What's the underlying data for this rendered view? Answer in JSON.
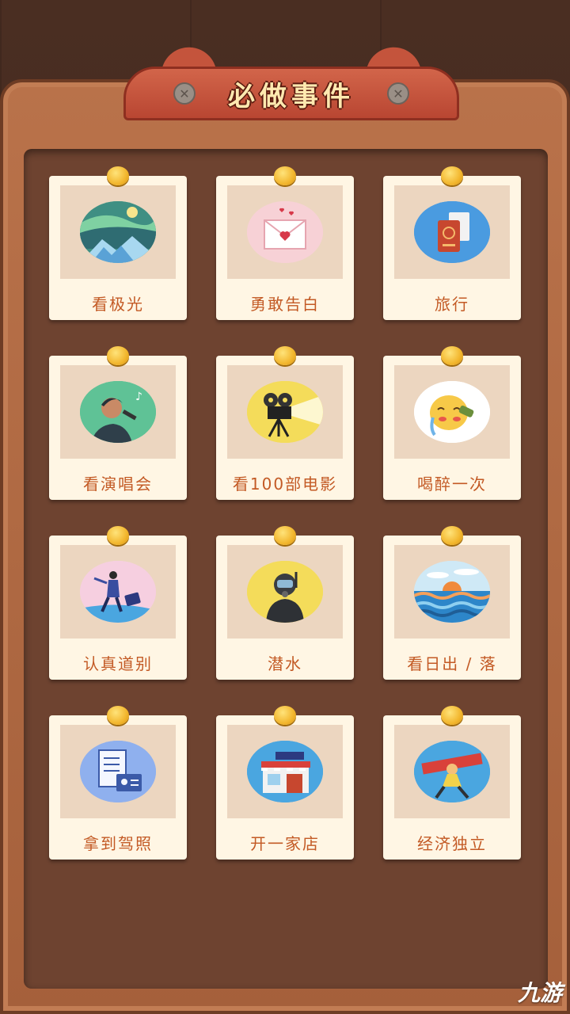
{
  "title": "必做事件",
  "cards": [
    {
      "label": "看极光",
      "icon": "aurora-icon",
      "color": "#f1c54c"
    },
    {
      "label": "勇敢告白",
      "icon": "love-letter-icon",
      "color": "#f7d1d6"
    },
    {
      "label": "旅行",
      "icon": "passport-icon",
      "color": "#4a9be0"
    },
    {
      "label": "看演唱会",
      "icon": "singer-icon",
      "color": "#5fc296"
    },
    {
      "label": "看100部电影",
      "icon": "movie-projector-icon",
      "color": "#f4dc5a"
    },
    {
      "label": "喝醉一次",
      "icon": "drunk-face-icon",
      "color": "#ffffff"
    },
    {
      "label": "认真道别",
      "icon": "traveler-icon",
      "color": "#f6cfe0"
    },
    {
      "label": "潜水",
      "icon": "diver-icon",
      "color": "#f4dc5a"
    },
    {
      "label": "看日出 / 落",
      "icon": "sunset-icon",
      "color": "#cfe9f6"
    },
    {
      "label": "拿到驾照",
      "icon": "driver-license-icon",
      "color": "#8fb0ee"
    },
    {
      "label": "开一家店",
      "icon": "shop-icon",
      "color": "#4aa6e0"
    },
    {
      "label": "经济独立",
      "icon": "flying-money-icon",
      "color": "#4aa6e0"
    }
  ],
  "watermark": "九游"
}
